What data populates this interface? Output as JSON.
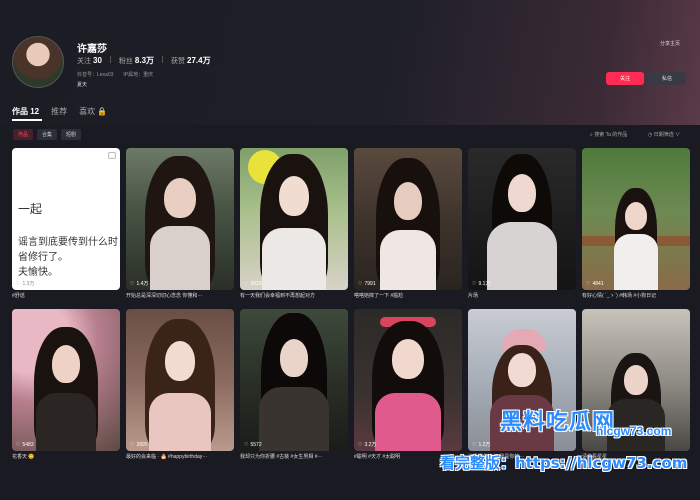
{
  "profile": {
    "name": "许嘉莎",
    "following_label": "关注",
    "following_value": "30",
    "followers_label": "粉丝",
    "followers_value": "8.3万",
    "likes_label": "获赞",
    "likes_value": "27.4万",
    "account_id": "抖音号：Lexa03",
    "ip_location": "IP属地：重庆",
    "bio": "夏天"
  },
  "header": {
    "share_label": "分享主页",
    "follow_label": "关注",
    "message_label": "私信"
  },
  "tabs": [
    {
      "label": "作品 12"
    },
    {
      "label": "推荐"
    },
    {
      "label": "喜欢 🔒"
    }
  ],
  "subtabs": [
    {
      "label": "作品"
    },
    {
      "label": "合集"
    },
    {
      "label": "短剧"
    }
  ],
  "toolbar": {
    "search_label": "⌕ 搜索 Ta 的作品",
    "sort_label": "◷ 日期筛选 ∨"
  },
  "posts": [
    {
      "plays": "1.3万",
      "caption": "#舒谣",
      "text_lines": [
        "一起",
        "谣言到底要传到什么时",
        "省修行了。",
        "夫愉快。"
      ]
    },
    {
      "plays": "1.4万",
      "caption": "开始总是深深切切心念念 你懂和···"
    },
    {
      "plays": "6023",
      "caption": "有一天我们会幸福到不再想起对方"
    },
    {
      "plays": "7991",
      "caption": "嗒嗒她摔了一下 #尴尬"
    },
    {
      "plays": "9.1万",
      "caption": "片场"
    },
    {
      "plays": "4841",
      "caption": "有好心情( ´_ゝ`) #韩场 #小狗日记"
    },
    {
      "plays": "5483",
      "caption": "花香天 😊"
    },
    {
      "plays": "2895",
      "caption": "最好的会来临 · 🎂 #happybirthday···"
    },
    {
      "plays": "5572",
      "caption": "我却只为你折腰 #古装 #女生男相 #···"
    },
    {
      "plays": "3.2万",
      "caption": "#聪明 #天才 #太聪明"
    },
    {
      "plays": "1.2万",
      "caption": "这是雪的尚初,我是你的···"
    },
    {
      "plays": "",
      "caption": "请你看星星"
    }
  ],
  "watermark": {
    "brand": "黑料吃瓜网",
    "domain": "hlcgw73.com",
    "full_line": "看完整版：https://hlcgw73.com"
  },
  "colors": {
    "accent": "#fe2c55",
    "background": "#1a1a22",
    "watermark": "#2b8cff"
  }
}
